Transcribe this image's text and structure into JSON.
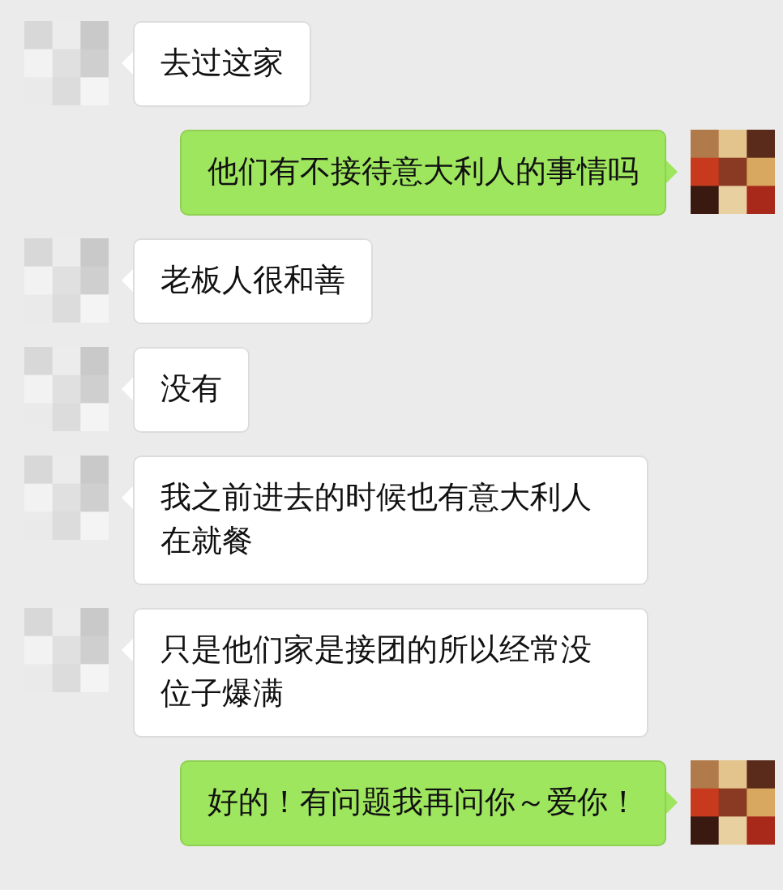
{
  "messages": [
    {
      "kind": "received",
      "text": "去过这家"
    },
    {
      "kind": "sent",
      "text": "他们有不接待意大利人的事情吗"
    },
    {
      "kind": "received",
      "text": "老板人很和善"
    },
    {
      "kind": "received",
      "text": "没有"
    },
    {
      "kind": "received",
      "text": "我之前进去的时候也有意大利人在就餐"
    },
    {
      "kind": "received",
      "text": "只是他们家是接团的所以经常没位子爆满"
    },
    {
      "kind": "sent",
      "text": "好的！有问题我再问你～爱你！"
    }
  ]
}
